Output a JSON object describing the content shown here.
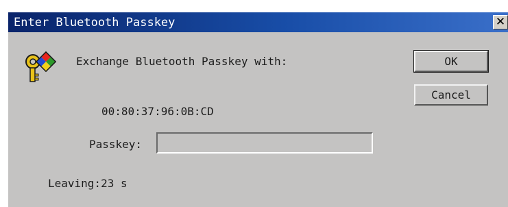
{
  "window": {
    "title": "Enter Bluetooth Passkey",
    "close_glyph": "✕"
  },
  "icon": "key-icon",
  "message": "Exchange Bluetooth Passkey with:",
  "device_address": "00:80:37:96:0B:CD",
  "passkey": {
    "label": "Passkey:",
    "value": "",
    "placeholder": ""
  },
  "status": "Leaving:23 s",
  "buttons": {
    "ok": "OK",
    "cancel": "Cancel"
  },
  "colors": {
    "titlebar_start": "#0a246a",
    "titlebar_end": "#3a6fc9",
    "dialog_bg": "#c4c3c2"
  }
}
